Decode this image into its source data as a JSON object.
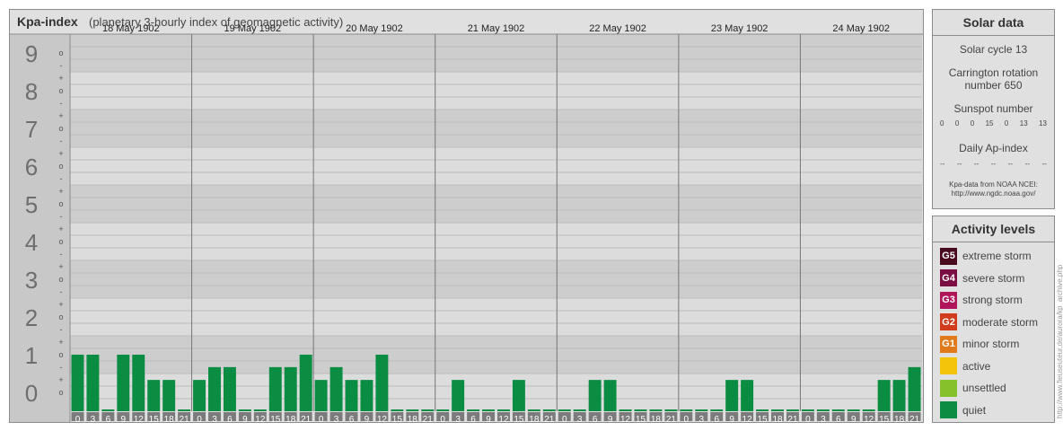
{
  "header": {
    "title": "Kpa-index",
    "subtitle": "(planetary 3-hourly index of geomagnetic activity)"
  },
  "chart_data": {
    "type": "bar",
    "ylim": [
      0,
      9
    ],
    "y_major_ticks": [
      "0",
      "1",
      "2",
      "3",
      "4",
      "5",
      "6",
      "7",
      "8",
      "9"
    ],
    "y_minor_marks": [
      "o",
      "+",
      "-",
      "o",
      "+",
      "-",
      "o",
      "+",
      "-",
      "o",
      "+",
      "-",
      "o",
      "+",
      "-",
      "o",
      "+",
      "-",
      "o",
      "+",
      "-",
      "o",
      "+",
      "-",
      "o",
      "+",
      "-",
      "o"
    ],
    "days": [
      "18 May 1902",
      "19 May 1902",
      "20 May 1902",
      "21 May 1902",
      "22 May 1902",
      "23 May 1902",
      "24 May 1902"
    ],
    "interval_start": [
      "0",
      "3",
      "6",
      "9",
      "12",
      "15",
      "18",
      "21"
    ],
    "interval_end": [
      "3",
      "6",
      "9",
      "12",
      "15",
      "18",
      "21",
      "24"
    ],
    "values": [
      1.0,
      1.0,
      0.0,
      1.0,
      1.0,
      0.33,
      0.33,
      0.0,
      0.33,
      0.67,
      0.67,
      0.0,
      0.0,
      0.67,
      0.67,
      1.0,
      0.33,
      0.67,
      0.33,
      0.33,
      1.0,
      0.0,
      0.0,
      0.0,
      0.0,
      0.33,
      0.0,
      0.0,
      0.0,
      0.33,
      0.0,
      0.0,
      0.0,
      0.0,
      0.33,
      0.33,
      0.0,
      0.0,
      0.0,
      0.0,
      0.0,
      0.0,
      0.0,
      0.33,
      0.33,
      0.0,
      0.0,
      0.0,
      0.0,
      0.0,
      0.0,
      0.0,
      0.0,
      0.33,
      0.33,
      0.67
    ],
    "bar_color": "#0a8c43",
    "band_colors": [
      "#cdcdcd",
      "#dcdcdc"
    ],
    "grid": true
  },
  "solar": {
    "heading": "Solar data",
    "cycle": "Solar cycle 13",
    "carrington_line1": "Carrington rotation",
    "carrington_line2": "number 650",
    "sunspot_heading": "Sunspot number",
    "sunspot_values": [
      "0",
      "0",
      "0",
      "15",
      "0",
      "13",
      "13"
    ],
    "ap_heading": "Daily Ap-index",
    "ap_values": [
      "--",
      "--",
      "--",
      "--",
      "--",
      "--",
      "--"
    ],
    "credit_line1": "Kpa-data from NOAA NCEI:",
    "credit_line2": "http://www.ngdc.noaa.gov/"
  },
  "activity": {
    "heading": "Activity levels",
    "levels": [
      {
        "code": "G5",
        "label": "extreme storm",
        "color": "#4a0a1e"
      },
      {
        "code": "G4",
        "label": "severe storm",
        "color": "#7a0e42"
      },
      {
        "code": "G3",
        "label": "strong storm",
        "color": "#b0145a"
      },
      {
        "code": "G2",
        "label": "moderate storm",
        "color": "#d03c1c"
      },
      {
        "code": "G1",
        "label": "minor storm",
        "color": "#e07a1a"
      },
      {
        "code": "",
        "label": "active",
        "color": "#f4c40a"
      },
      {
        "code": "",
        "label": "unsettled",
        "color": "#86c02a"
      },
      {
        "code": "",
        "label": "quiet",
        "color": "#0a8c43"
      }
    ]
  },
  "side_url": "http://www.fieuseuteur.de/aurora/kp_archive.php"
}
